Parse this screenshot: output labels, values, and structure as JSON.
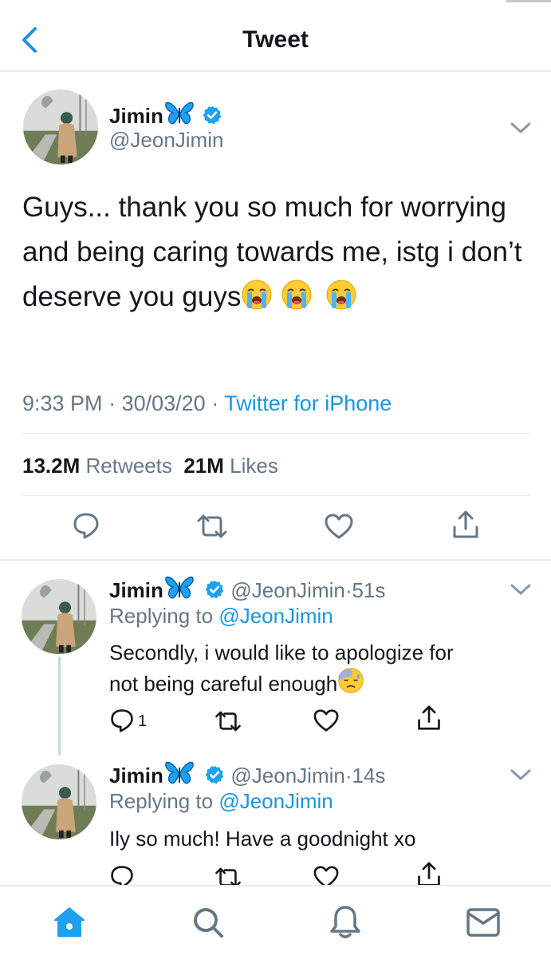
{
  "header": {
    "title": "Tweet"
  },
  "main_tweet": {
    "name": "Jimin",
    "handle": "@JeonJimin",
    "text": "Guys... thank you so much for worrying and being caring towards me, istg i don’t deserve you guys",
    "time": "9:33 PM",
    "date": "30/03/20",
    "source": "Twitter for iPhone",
    "separator": "·",
    "retweets_count": "13.2M",
    "retweets_label": "Retweets",
    "likes_count": "21M",
    "likes_label": "Likes"
  },
  "replies": [
    {
      "name": "Jimin",
      "handle": "@JeonJimin",
      "time": "51s",
      "replying_label": "Replying to",
      "replying_to": "@JeonJimin",
      "text_line1": "Secondly, i would like to apologize for",
      "text_line2": "not being careful enough",
      "reply_count": "1"
    },
    {
      "name": "Jimin",
      "handle": "@JeonJimin",
      "time": "14s",
      "replying_label": "Replying to",
      "replying_to": "@JeonJimin",
      "text_line1": "Ily so much! Have a goodnight xo"
    }
  ],
  "icons": {
    "verified": "verified-badge-icon",
    "butterfly": "butterfly-emoji",
    "cry": "loudly-crying-face-emoji",
    "sweat": "downcast-face-with-sweat-emoji"
  },
  "colors": {
    "accent": "#1b95e0",
    "muted": "#657786",
    "text": "#14171a",
    "divider": "#e6ecf0"
  }
}
